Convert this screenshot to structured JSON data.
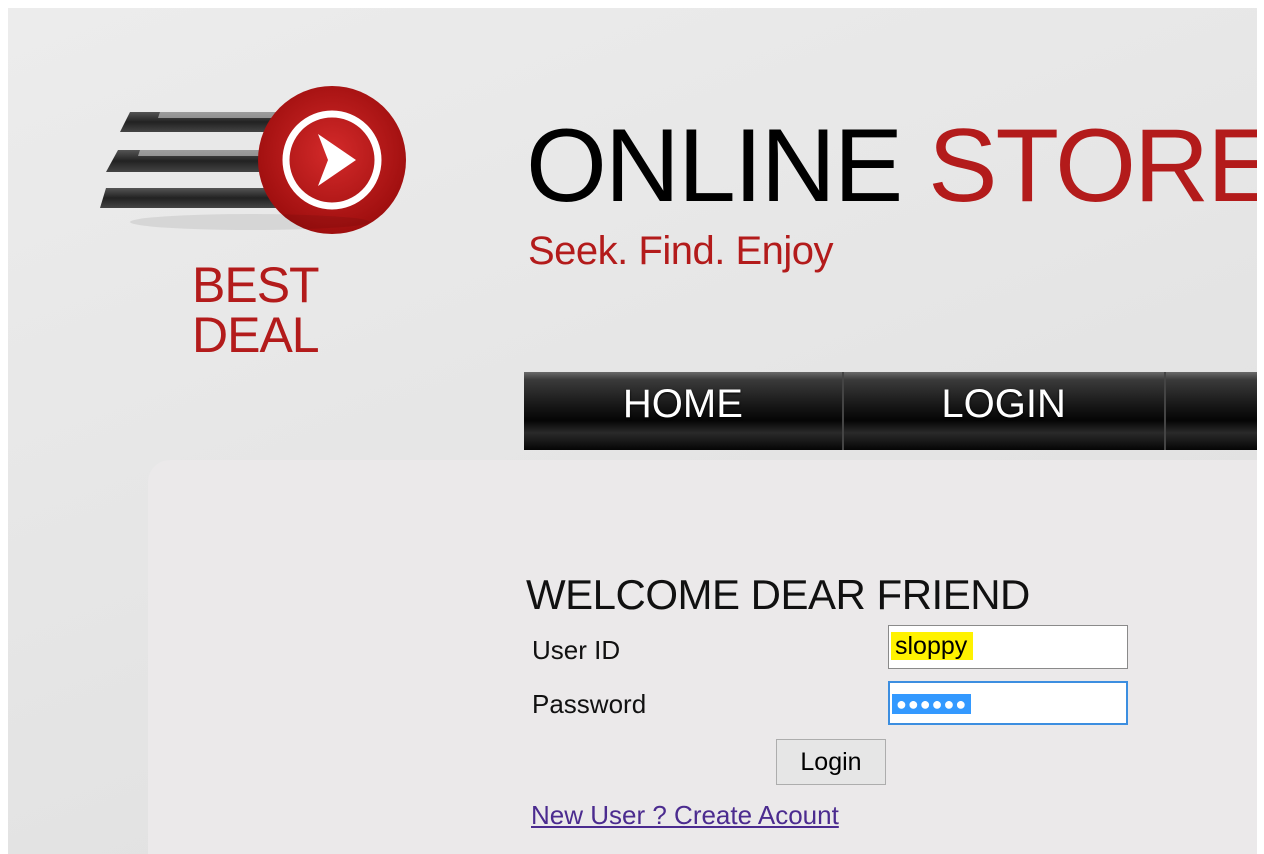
{
  "brand": {
    "logo_icon": "play-arrow-speed-logo",
    "logo_line1": "BEST",
    "logo_line2": "DEAL",
    "title_part1": "ONLINE ",
    "title_part2": "STORE",
    "tagline": "Seek. Find. Enjoy",
    "accent_color": "#b31b1b"
  },
  "nav": {
    "items": [
      {
        "label": "HOME"
      },
      {
        "label": "LOGIN"
      },
      {
        "label": ""
      }
    ]
  },
  "login_form": {
    "heading": "WELCOME DEAR FRIEND",
    "user_id_label": "User ID",
    "user_id_value": "sloppy",
    "password_label": "Password",
    "password_masked": "●●●●●●",
    "submit_label": "Login",
    "create_account_link": "New User ? Create Acount"
  }
}
